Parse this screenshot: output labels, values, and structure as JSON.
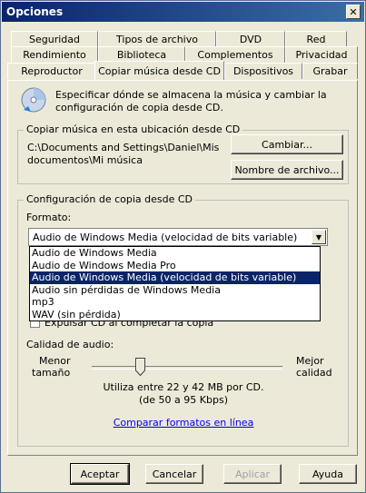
{
  "window": {
    "title": "Opciones",
    "close_glyph": "✕"
  },
  "tabs": {
    "row1": [
      "Seguridad",
      "Tipos de archivo",
      "DVD",
      "Red"
    ],
    "row2": [
      "Rendimiento",
      "Biblioteca",
      "Complementos",
      "Privacidad"
    ],
    "row3": [
      "Reproductor",
      "Copiar música desde CD",
      "Dispositivos",
      "Grabar"
    ]
  },
  "header": {
    "icon": "cd-icon",
    "line1": "Especificar dónde se almacena la música y cambiar la",
    "line2": "configuración de copia desde CD."
  },
  "location_group": {
    "title": "Copiar música en esta ubicación desde CD",
    "path_line1": "C:\\Documents and Settings\\Daniel\\Mis",
    "path_line2": "documentos\\Mi música",
    "change_button": "Cambiar...",
    "filename_button": "Nombre de archivo..."
  },
  "settings_group": {
    "title": "Configuración de copia desde CD",
    "format_label": "Formato:",
    "format_selected": "Audio de Windows Media (velocidad de bits variable)",
    "format_options": [
      "Audio de Windows Media",
      "Audio de Windows Media Pro",
      "Audio de Windows Media (velocidad de bits variable)",
      "Audio sin pérdidas de Windows Media",
      "mp3",
      "WAV (sin pérdida)"
    ],
    "selected_index": 2,
    "eject_checkbox": "Expulsar CD al completar la copia",
    "quality_label": "Calidad de audio:",
    "smaller_1": "Menor",
    "smaller_2": "tamaño",
    "better_1": "Mejor",
    "better_2": "calidad",
    "usage_1": "Utiliza entre 22 y 42 MB por CD.",
    "usage_2": "(de 50 a 95 Kbps)",
    "compare_link": "Comparar formatos en línea"
  },
  "footer": {
    "ok": "Aceptar",
    "cancel": "Cancelar",
    "apply": "Aplicar",
    "help": "Ayuda"
  }
}
